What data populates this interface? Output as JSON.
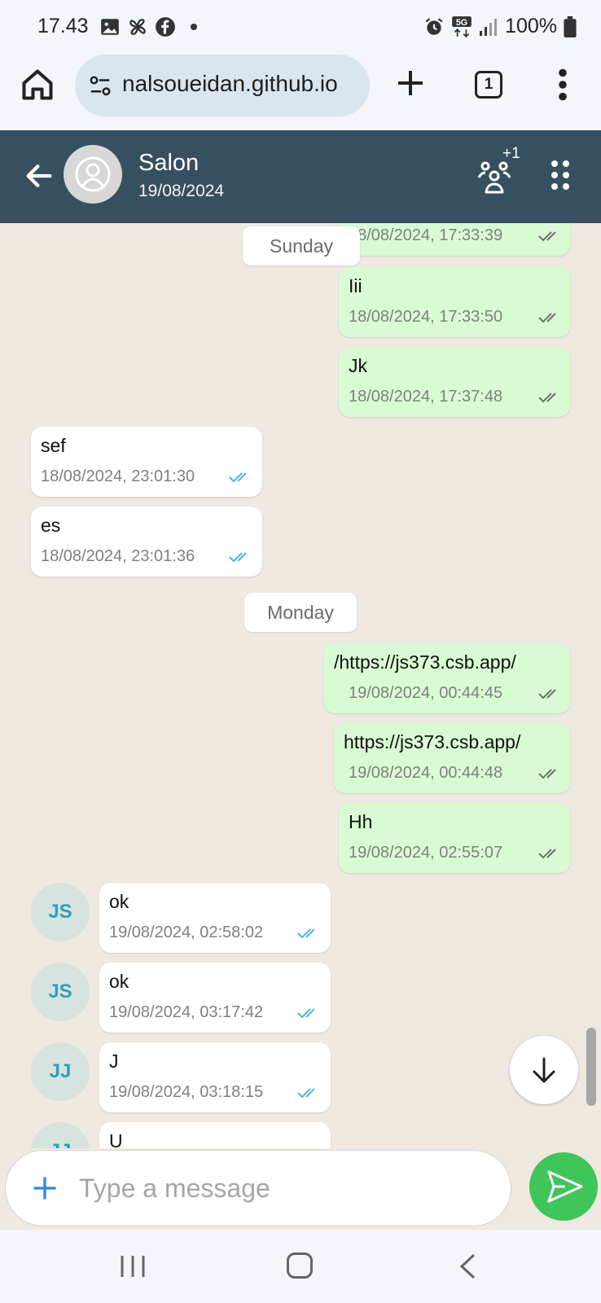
{
  "status_bar": {
    "time": "17.43",
    "battery": "100%",
    "network": "5G"
  },
  "browser": {
    "url": "nalsoueidan.github.io",
    "tab_count": "1"
  },
  "chat": {
    "title": "Salon",
    "date": "19/08/2024",
    "members_extra": "+1"
  },
  "day_separators": {
    "sunday": "Sunday",
    "monday": "Monday"
  },
  "messages": [
    {
      "text": "",
      "time": "18/08/2024, 17:33:39",
      "direction": "out"
    },
    {
      "text": "Iii",
      "time": "18/08/2024, 17:33:50",
      "direction": "out"
    },
    {
      "text": "Jk",
      "time": "18/08/2024, 17:37:48",
      "direction": "out"
    },
    {
      "text": "sef",
      "time": "18/08/2024, 23:01:30",
      "direction": "in"
    },
    {
      "text": "es",
      "time": "18/08/2024, 23:01:36",
      "direction": "in"
    },
    {
      "text": "/https://js373.csb.app/",
      "time": "19/08/2024, 00:44:45",
      "direction": "out"
    },
    {
      "text": "https://js373.csb.app/",
      "time": "19/08/2024, 00:44:48",
      "direction": "out"
    },
    {
      "text": "Hh",
      "time": "19/08/2024, 02:55:07",
      "direction": "out"
    },
    {
      "text": "ok",
      "time": "19/08/2024, 02:58:02",
      "direction": "in",
      "initials": "JS"
    },
    {
      "text": "ok",
      "time": "19/08/2024, 03:17:42",
      "direction": "in",
      "initials": "JS"
    },
    {
      "text": "J",
      "time": "19/08/2024, 03:18:15",
      "direction": "in",
      "initials": "JJ"
    },
    {
      "text": "U",
      "time": "",
      "direction": "in",
      "initials": "JJ"
    }
  ],
  "composer": {
    "placeholder": "Type a message"
  },
  "colors": {
    "header_bg": "#37505f",
    "outgoing_bubble": "#d9fbd3",
    "incoming_bubble": "#ffffff",
    "chat_bg": "#efe9e2",
    "read_tick": "#4fb3d9",
    "sent_tick": "#707070",
    "send_button": "#40c55a"
  }
}
